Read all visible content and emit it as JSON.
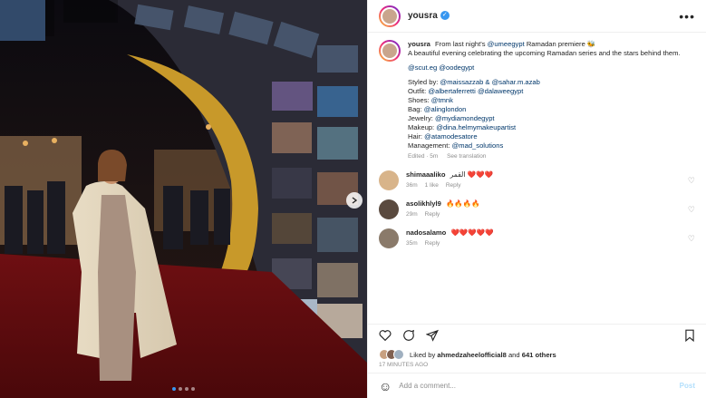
{
  "post": {
    "username": "yousra",
    "more_label": "•••",
    "caption": {
      "username": "yousra",
      "line1_prefix": "From last night's",
      "mention_1": "@umeegypt",
      "line1_suffix": "Ramadan premiere",
      "line2": "A beautiful evening celebrating the upcoming Ramadan series and the stars behind them.",
      "tags": "@scut.eg @oodegypt",
      "credits": [
        {
          "label": "Styled by:",
          "value": "@maissazzab & @sahar.m.azab"
        },
        {
          "label": "Outfit:",
          "value": "@albertaferretti @dalaweegypt"
        },
        {
          "label": "Shoes:",
          "value": "@tmnk"
        },
        {
          "label": "Bag:",
          "value": "@alinglondon"
        },
        {
          "label": "Jewelry:",
          "value": "@mydiamondegypt"
        },
        {
          "label": "Makeup:",
          "value": "@dina.helmymakeupartist"
        },
        {
          "label": "Hair:",
          "value": "@atamodesatore"
        },
        {
          "label": "Management:",
          "value": "@mad_solutions"
        }
      ],
      "edited": "Edited · 5m",
      "see_translation": "See translation"
    },
    "comments": [
      {
        "username": "shimaaaliko",
        "text": "القمر ❤️❤️❤️",
        "time": "36m",
        "likes": "1 like",
        "reply": "Reply",
        "avatar_color": "#d8b48a"
      },
      {
        "username": "asolikhlyl9",
        "text": "🔥🔥🔥🔥",
        "time": "29m",
        "likes": "",
        "reply": "Reply",
        "avatar_color": "#5a4a3f"
      },
      {
        "username": "nadosalamo",
        "text": "❤️❤️❤️❤️❤️",
        "time": "35m",
        "likes": "",
        "reply": "Reply",
        "avatar_color": "#8a7a6a"
      }
    ],
    "liked_by_prefix": "Liked by",
    "liked_by_user": "ahmedzaheelofficial8",
    "liked_by_and": "and",
    "liked_by_others": "641 others",
    "time_ago": "17 minutes ago",
    "add_comment_placeholder": "Add a comment...",
    "post_button": "Post",
    "emoji_icon": "☺"
  },
  "carousel": {
    "total": 4,
    "active": 0
  },
  "colors": {
    "link": "#00376b",
    "accent": "#3897f0",
    "muted": "#8e8e8e"
  }
}
